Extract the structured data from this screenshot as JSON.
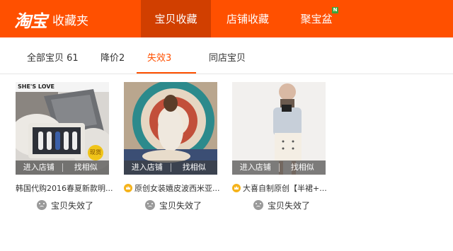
{
  "header": {
    "logo_mark": "淘宝",
    "logo_sub": "收藏夹",
    "nav": [
      {
        "label": "宝贝收藏"
      },
      {
        "label": "店铺收藏"
      },
      {
        "label": "聚宝盆"
      }
    ],
    "new_badge": "N",
    "colors": {
      "brand": "#ff5000",
      "active_nav": "#d13f00"
    }
  },
  "tabs": [
    {
      "label": "全部宝贝 61"
    },
    {
      "label": "降价2"
    },
    {
      "label": "失效3"
    },
    {
      "label": "同店宝贝"
    }
  ],
  "items": [
    {
      "brand_text": "SHE'S LOVE",
      "title": "韩国代购2016春夏新款明...",
      "enter_shop": "进入店铺",
      "find_similar": "找相似",
      "status": "宝贝失效了",
      "stock_label": "现货"
    },
    {
      "title": "原创女装嬉皮波西米亚...",
      "enter_shop": "进入店铺",
      "find_similar": "找相似",
      "status": "宝贝失效了"
    },
    {
      "title": "大喜自制原创【半裙+...",
      "enter_shop": "进入店铺",
      "find_similar": "找相似",
      "status": "宝贝失效了"
    }
  ]
}
